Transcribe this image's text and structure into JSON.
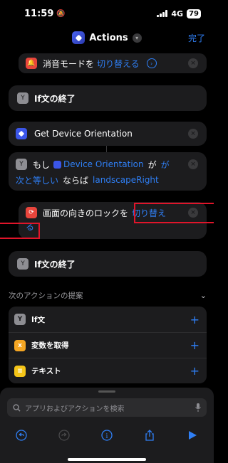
{
  "status": {
    "time": "11:59",
    "network": "4G",
    "battery": "79"
  },
  "nav": {
    "title": "Actions",
    "done_label": "完了"
  },
  "actions": {
    "silent_mode": {
      "text": "消音モードを",
      "param": "切り替える"
    },
    "end_if_1": {
      "label": "If文の終了"
    },
    "get_orientation": {
      "label": "Get Device Orientation"
    },
    "if_block": {
      "prefix": "もし",
      "variable": "Device Orientation",
      "particle": "が",
      "condition_a": "が",
      "condition_b": "次と等しい",
      "then": "ならば",
      "value": "landscapeRight"
    },
    "rotation_lock": {
      "text": "画面の向きのロックを",
      "param_a": "切り替え",
      "param_b": "る"
    },
    "end_if_2": {
      "label": "If文の終了"
    }
  },
  "suggestions": {
    "header": "次のアクションの提案",
    "items": [
      {
        "label": "If文",
        "icon": "if-icon",
        "color": "#8e8e93"
      },
      {
        "label": "変数を取得",
        "icon": "variable-icon",
        "color": "#f5a623"
      },
      {
        "label": "テキスト",
        "icon": "text-icon",
        "color": "#f5c518"
      }
    ]
  },
  "search": {
    "placeholder": "アプリおよびアクションを検索"
  },
  "colors": {
    "accent": "#2f7ff5",
    "highlight": "#e0152a",
    "card": "#1c1c1e"
  }
}
